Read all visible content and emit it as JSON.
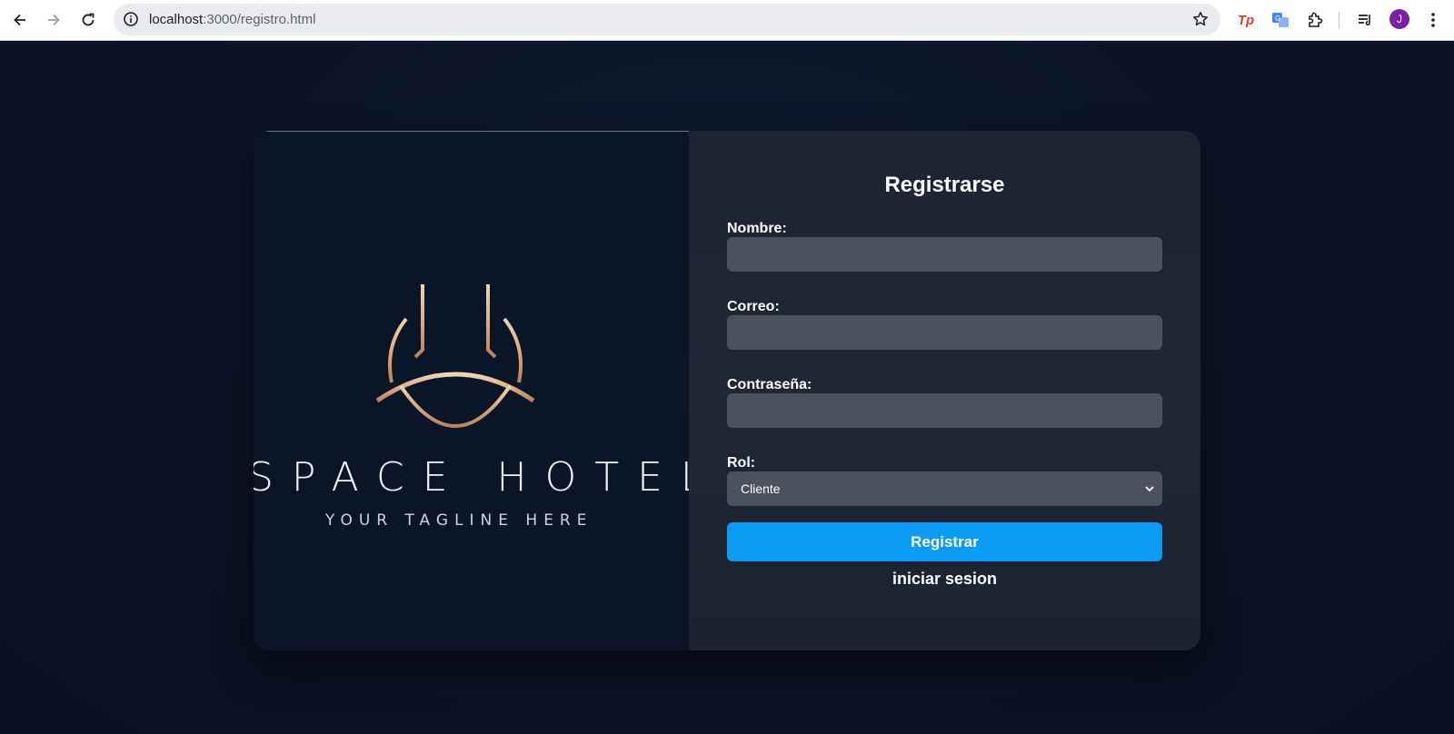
{
  "browser": {
    "url_host": "localhost",
    "url_path": ":3000/registro.html",
    "extensions": [
      {
        "name": "tp-extension",
        "label": "Tp"
      },
      {
        "name": "translate-extension"
      },
      {
        "name": "puzzle-extension"
      }
    ],
    "avatar_initial": "J",
    "avatar_color": "#7b1fa2"
  },
  "brand": {
    "name": "SPACE HOTEL",
    "tagline": "YOUR TAGLINE HERE",
    "logo_color": "#d9a77e"
  },
  "form": {
    "title": "Registrarse",
    "fields": [
      {
        "label": "Nombre:",
        "value": ""
      },
      {
        "label": "Correo:",
        "value": ""
      },
      {
        "label": "Contraseña:",
        "value": ""
      }
    ],
    "role": {
      "label": "Rol:",
      "selected": "Cliente"
    },
    "submit_label": "Registrar",
    "login_link": "iniciar sesion"
  },
  "colors": {
    "accent": "#0b9bf4",
    "background": "#0b1428",
    "panel": "#1c2433",
    "input": "#4b515d"
  }
}
